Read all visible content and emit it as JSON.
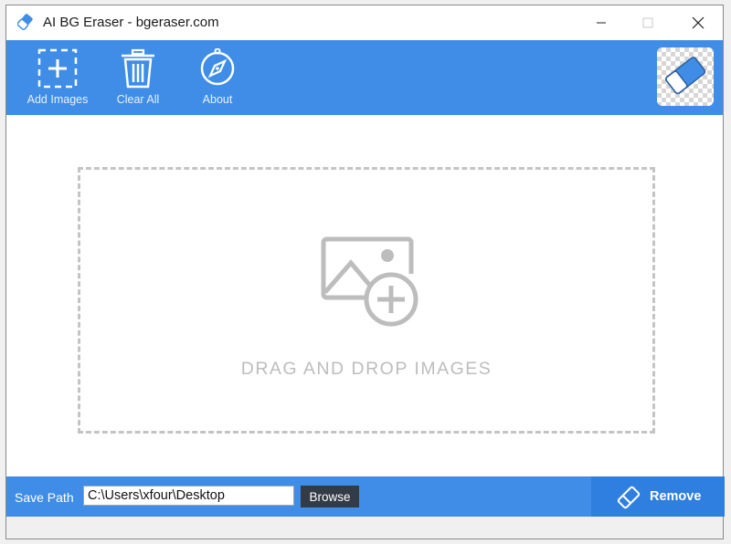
{
  "window": {
    "title": "AI BG Eraser - bgeraser.com",
    "controls": [
      "minimize-icon",
      "maximize-icon",
      "close-icon"
    ]
  },
  "toolbar": {
    "items": [
      {
        "label": "Add Images",
        "icon": "add-image-icon"
      },
      {
        "label": "Clear All",
        "icon": "trash-icon"
      },
      {
        "label": "About",
        "icon": "compass-icon"
      }
    ],
    "logo_icon": "eraser-icon"
  },
  "main": {
    "drop_zone_text": "DRAG AND DROP IMAGES",
    "drop_zone_icon": "image-add-icon"
  },
  "footer": {
    "save_path_label": "Save Path",
    "save_path_value": "C:\\Users\\xfour\\Desktop",
    "browse_label": "Browse",
    "remove_label": "Remove",
    "remove_icon": "eraser-outline-icon"
  },
  "colors": {
    "accent": "#3f8de6",
    "remove_button": "#2f7fe0",
    "browse_button": "#333b46",
    "drop_border": "#c4c4c4",
    "drop_text": "#bdbdbd"
  }
}
